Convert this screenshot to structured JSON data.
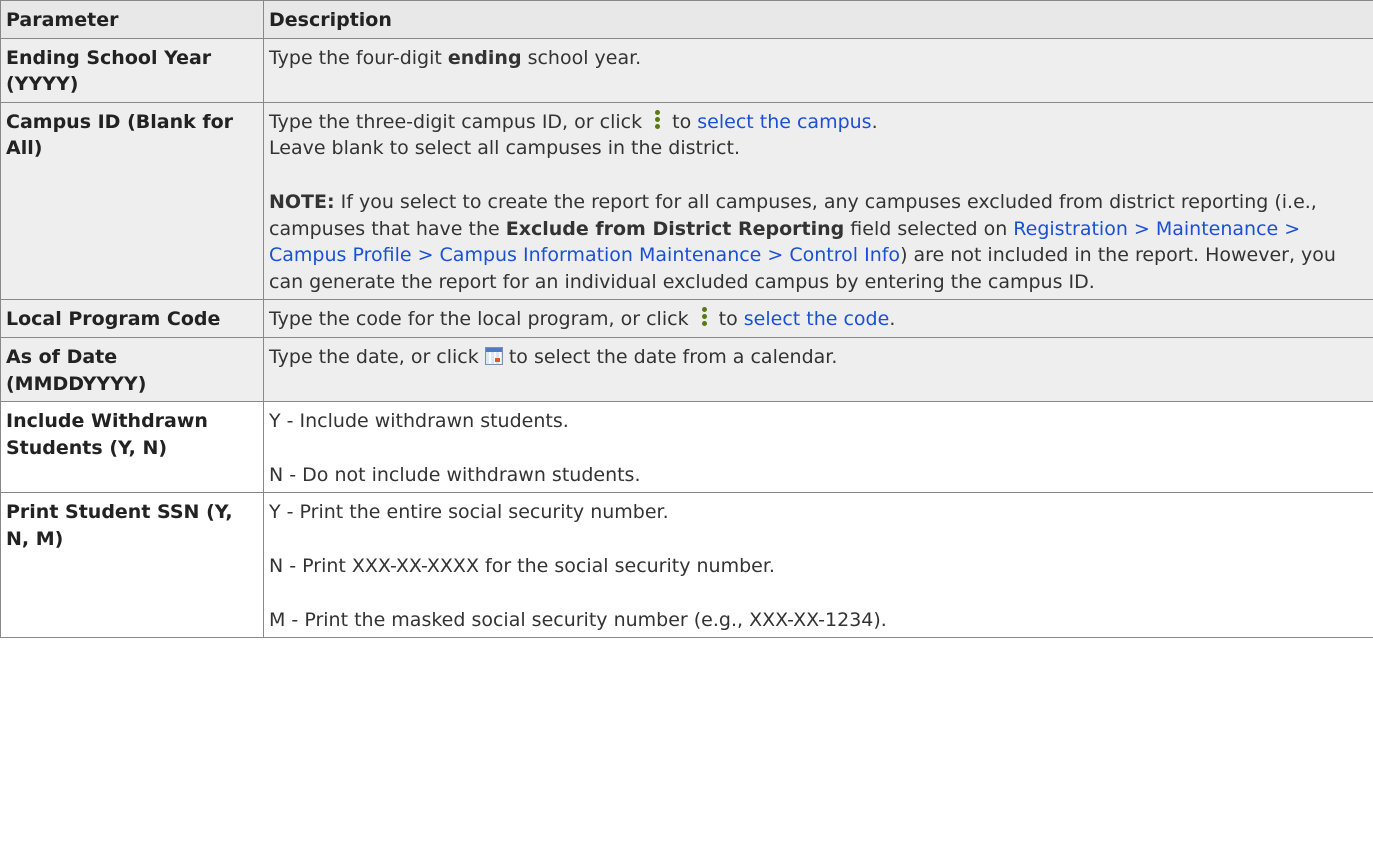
{
  "header": {
    "col1": "Parameter",
    "col2": "Description"
  },
  "rows": {
    "r1": {
      "name": "Ending School Year (YYYY)",
      "t1": "Type the four-digit ",
      "b1": "ending",
      "t2": " school year."
    },
    "r2": {
      "name": "Campus ID (Blank for All)",
      "t1": "Type the three-digit campus ID, or click ",
      "icon": "vertical-dots-icon",
      "t2": " to ",
      "link1": "select the campus",
      "t3": ".",
      "t4": "Leave blank to select all campuses in the district.",
      "note_label": "NOTE:",
      "n1": " If you select to create the report for all campuses, any campuses excluded from district reporting (i.e., campuses that have the ",
      "n_bold": "Exclude from District Reporting",
      "n2": " field selected on ",
      "link2": "Registration > Maintenance > Campus Profile > Campus Information Maintenance > Control Info",
      "n3": ") are not included in the report. However, you can generate the report for an individual excluded campus by entering the campus ID."
    },
    "r3": {
      "name": "Local Program Code",
      "t1": "Type the code for the local program, or click ",
      "icon": "vertical-dots-icon",
      "t2": " to ",
      "link1": "select the code",
      "t3": "."
    },
    "r4": {
      "name": "As of Date (MMDDYYYY)",
      "t1": "Type the date, or click ",
      "icon": "calendar-icon",
      "t2": " to select the date from a calendar."
    },
    "r5": {
      "name": "Include Withdrawn Students (Y, N)",
      "opt1": "Y - Include withdrawn students.",
      "opt2": "N - Do not include withdrawn students."
    },
    "r6": {
      "name": "Print Student SSN (Y, N, M)",
      "opt1": "Y - Print the entire social security number.",
      "opt2": "N - Print XXX-XX-XXXX for the social security number.",
      "opt3": "M - Print the masked social security number (e.g., XXX-XX-1234)."
    }
  },
  "colors": {
    "link": "#1a50d4",
    "header_bg": "#e8e8e8",
    "row_grey": "#eeeeee",
    "row_white": "#ffffff",
    "border": "#888888"
  }
}
